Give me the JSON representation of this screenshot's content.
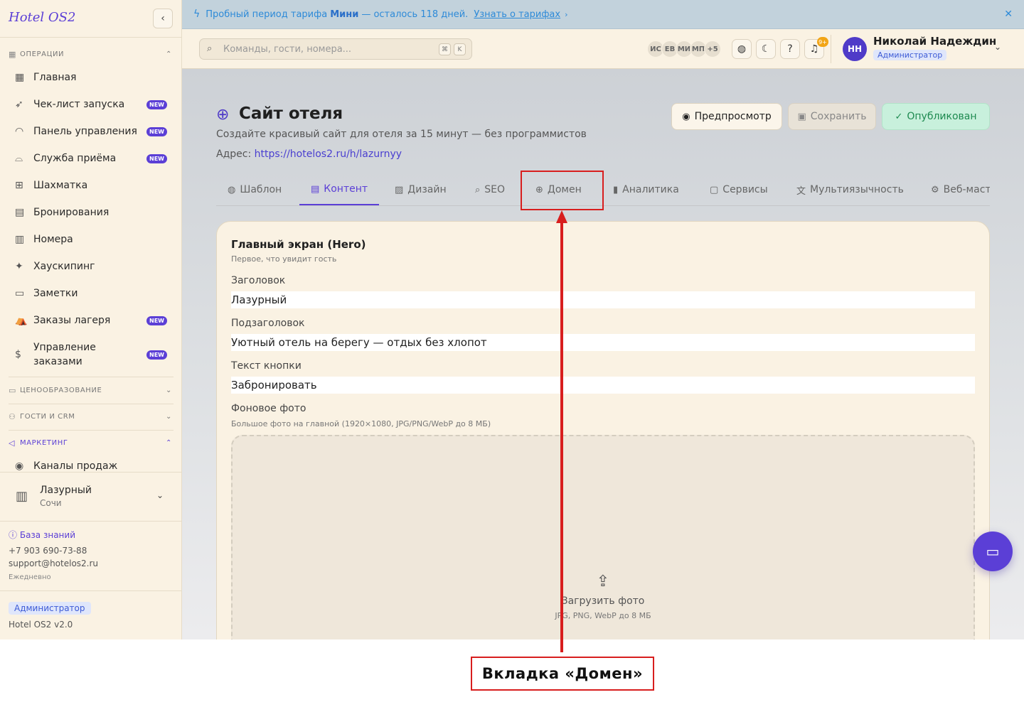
{
  "app": {
    "brand": "Hotel OS2",
    "collapse_icon": "chevron-left-icon"
  },
  "sidebar": {
    "sections": [
      {
        "label": "ОПЕРАЦИИ",
        "expanded": true
      },
      {
        "label": "ЦЕНООБРАЗОВАНИЕ",
        "expanded": false
      },
      {
        "label": "ГОСТИ И CRM",
        "expanded": false
      },
      {
        "label": "МАРКЕТИНГ",
        "expanded": true
      }
    ],
    "items": [
      {
        "label": "Главная",
        "icon": "dashboard-icon",
        "badge": ""
      },
      {
        "label": "Чек-лист запуска",
        "icon": "rocket-icon",
        "badge": "NEW"
      },
      {
        "label": "Панель управления",
        "icon": "gauge-icon",
        "badge": "NEW"
      },
      {
        "label": "Служба приёма",
        "icon": "concierge-bell-icon",
        "badge": "NEW"
      },
      {
        "label": "Шахматка",
        "icon": "grid-icon",
        "badge": ""
      },
      {
        "label": "Бронирования",
        "icon": "clipboard-icon",
        "badge": ""
      },
      {
        "label": "Номера",
        "icon": "building-icon",
        "badge": ""
      },
      {
        "label": "Хаускипинг",
        "icon": "sparkles-icon",
        "badge": ""
      },
      {
        "label": "Заметки",
        "icon": "note-icon",
        "badge": ""
      },
      {
        "label": "Заказы лагеря",
        "icon": "tent-icon",
        "badge": "NEW"
      },
      {
        "label_line1": "Управление",
        "label_line2": "заказами",
        "icon": "dollar-receipt-icon",
        "badge": "NEW"
      },
      {
        "label": "Каналы продаж",
        "icon": "broadcast-icon",
        "badge": ""
      }
    ],
    "hotel": {
      "name": "Лазурный",
      "city": "Сочи"
    },
    "knowledge_base": "База знаний",
    "phone": "+7 903 690-73-88",
    "email": "support@hotelos2.ru",
    "schedule": "Ежедневно",
    "role": "Администратор",
    "version": "Hotel OS2 v2.0"
  },
  "banner": {
    "text_before": "Пробный период тарифа",
    "plan": "Мини",
    "text_after": "— осталось 118 дней.",
    "link": "Узнать о тарифах"
  },
  "topbar": {
    "search_placeholder": "Команды, гости, номера...",
    "kbd1": "⌘",
    "kbd2": "K",
    "avatars": [
      "ИС",
      "ЕВ",
      "МИ",
      "МП",
      "+5"
    ],
    "notifications": "9+",
    "user_initials": "НН",
    "user_name": "Николай Надеждин",
    "user_role": "Администратор"
  },
  "page": {
    "title": "Сайт отеля",
    "subtitle": "Создайте красивый сайт для отеля за 15 минут — без программистов",
    "address_label": "Адрес:",
    "address_url": "https://hotelos2.ru/h/lazurnyy",
    "buttons": {
      "preview": "Предпросмотр",
      "save": "Сохранить",
      "published": "Опубликован"
    },
    "tabs": [
      {
        "label": "Шаблон",
        "icon": "palette-icon"
      },
      {
        "label": "Контент",
        "icon": "document-icon",
        "active": true
      },
      {
        "label": "Дизайн",
        "icon": "image-icon"
      },
      {
        "label": "SEO",
        "icon": "search-icon"
      },
      {
        "label": "Домен",
        "icon": "globe-icon"
      },
      {
        "label": "Аналитика",
        "icon": "bar-chart-icon"
      },
      {
        "label": "Сервисы",
        "icon": "chat-icon"
      },
      {
        "label": "Мультиязычность",
        "icon": "translate-icon"
      },
      {
        "label": "Веб-мастер",
        "icon": "gear-icon"
      }
    ]
  },
  "card": {
    "title": "Главный экран (Hero)",
    "subtitle": "Первое, что увидит гость",
    "fields": [
      {
        "label": "Заголовок",
        "value": "Лазурный"
      },
      {
        "label": "Подзаголовок",
        "value": "Уютный отель на берегу — отдых без хлопот"
      },
      {
        "label": "Текст кнопки",
        "value": "Забронировать"
      }
    ],
    "photo_label": "Фоновое фото",
    "photo_hint": "Большое фото на главной (1920×1080, JPG/PNG/WebP до 8 МБ)",
    "upload_text": "Загрузить фото",
    "upload_hint": "JPG, PNG, WebP до 8 МБ"
  },
  "annotation": {
    "callout": "Вкладка «Домен»",
    "color": "#d81e1e"
  }
}
